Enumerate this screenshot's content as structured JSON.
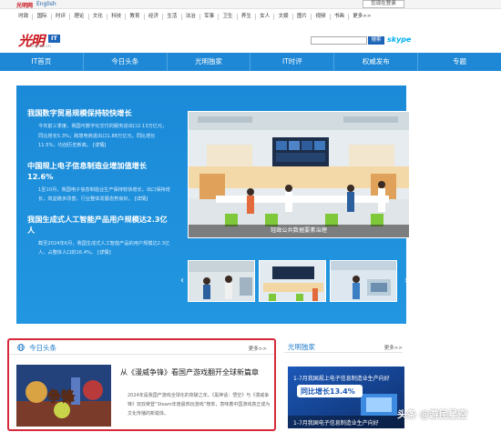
{
  "topbar": {
    "logo_text": "光明网",
    "language_link": "English",
    "login_button": "您现在登录"
  },
  "channels": [
    "时政",
    "国际",
    "时评",
    "理论",
    "文化",
    "科技",
    "教育",
    "经济",
    "生活",
    "法治",
    "军事",
    "卫生",
    "养生",
    "女人",
    "文娱",
    "图片",
    "视频",
    "书画",
    "更多>>"
  ],
  "header": {
    "logo_chars": "光明",
    "logo_badge": "IT",
    "logo_domain": "it.gmw.cn",
    "search_button": "搜索",
    "partner_logo": "skype"
  },
  "nav": [
    "IT首页",
    "今日头条",
    "光明独家",
    "IT时评",
    "权威发布",
    "专题"
  ],
  "feature": {
    "stories": [
      {
        "title": "我国数字贸易规模保持较快增长",
        "body": "今年前三季度，我国可数字化交付的服务进出口2.13万亿元，同比增长5.3%；跨境电商进出口1.88万亿元，同比增长11.5%，均创历史新高。",
        "detail": "[详情]"
      },
      {
        "title": "中国规上电子信息制造业增加值增长12.6%",
        "body": "1至10月，我国电子信息制造业生产保持较快增长，出口保持增长，效益稳步改善，行业整体发展态势良好。",
        "detail": "[详情]"
      },
      {
        "title": "我国生成式人工智能产品用户规模达2.3亿人",
        "body": "截至2024年6月，我国生成式人工智能产品的用户规模达2.3亿人，占整体人口的16.4%。",
        "detail": "[详情]"
      }
    ],
    "photo_caption": "轻政公共数据要素治理",
    "thumb_prev": "‹",
    "thumb_next": "›"
  },
  "today_panel": {
    "title": "今日头条",
    "more": "更多>>",
    "article_title": "从《漫威争锋》看国产游戏翻开全球新篇章",
    "article_body": "2024年是我国产游戏全球化的突破之年。《黑神话：悟空》与《漫威争锋》双双荣登“Steam年度最热玩游戏”榜单，意味着中国游戏真正成为文化传播的新载体。",
    "image_text": "争锋"
  },
  "guangming_panel": {
    "title": "光明独家",
    "more": "更多>>",
    "image_headline": "1-7月我国规上电子信息制造业生产向好",
    "image_highlight": "同比增长13.4%",
    "image_caption": "1-7月我国电子信息制造业生产向好"
  },
  "watermark": "头条 @游民星空",
  "colors": {
    "brand_blue": "#1e88d6",
    "feature_blue": "#1b8ad8",
    "highlight_red": "#d5283a",
    "logo_red": "#c8161d"
  }
}
